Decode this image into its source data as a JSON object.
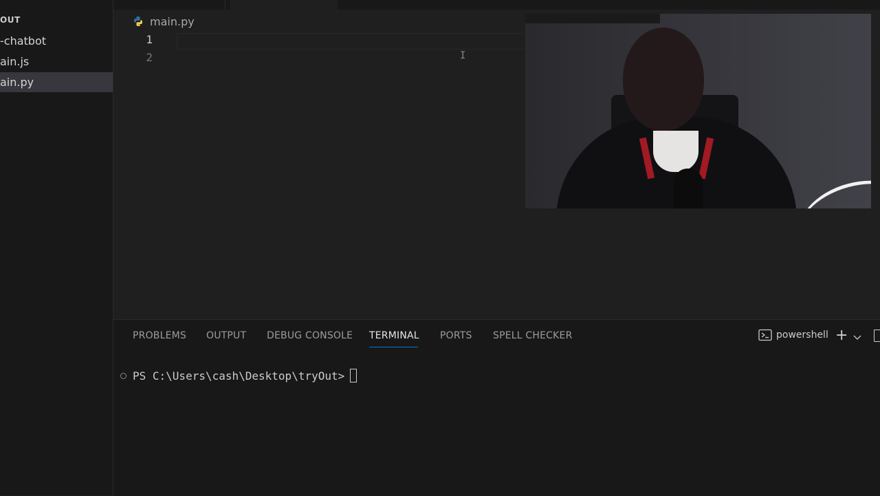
{
  "explorer": {
    "header": "OUT",
    "items": [
      {
        "label": "-chatbot",
        "selected": false
      },
      {
        "label": "ain.js",
        "selected": false
      },
      {
        "label": "ain.py",
        "selected": true
      }
    ]
  },
  "editor": {
    "breadcrumb_file": "main.py",
    "breadcrumb_icon": "python-icon",
    "line_numbers": [
      "1",
      "2"
    ],
    "active_line": 1,
    "cursor_glyph": "I"
  },
  "webcam": {
    "description_icon": "webcam-overlay"
  },
  "panel": {
    "tabs": [
      {
        "label": "PROBLEMS",
        "active": false
      },
      {
        "label": "OUTPUT",
        "active": false
      },
      {
        "label": "DEBUG CONSOLE",
        "active": false
      },
      {
        "label": "TERMINAL",
        "active": true
      },
      {
        "label": "PORTS",
        "active": false
      },
      {
        "label": "SPELL CHECKER",
        "active": false
      }
    ],
    "terminal_name": "powershell",
    "new_terminal_glyph": "+",
    "prompt": "PS C:\\Users\\cash\\Desktop\\tryOut>"
  },
  "colors": {
    "editor_bg": "#1f1f1f",
    "sidebar_bg": "#181818",
    "selected_item": "#37373d",
    "accent": "#0078d4",
    "python_blue": "#3572A5",
    "python_yellow": "#f1d24b"
  }
}
